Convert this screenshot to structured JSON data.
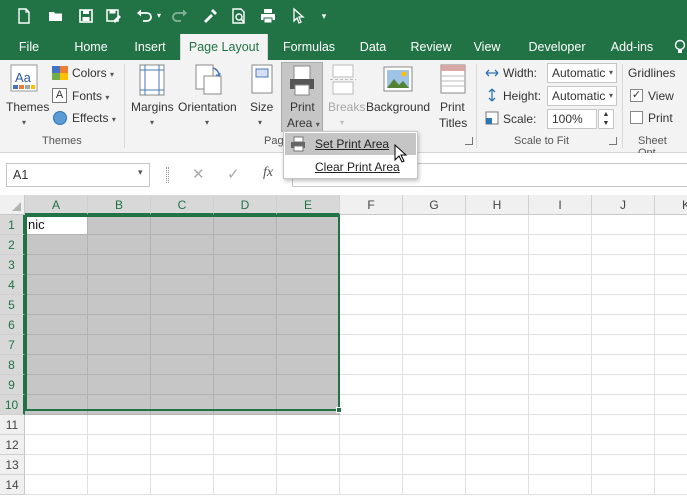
{
  "qat": {
    "icons": [
      "new-file-icon",
      "open-folder-icon",
      "save-icon",
      "save-as-icon",
      "undo-icon",
      "redo-icon",
      "format-painter-icon",
      "print-preview-icon",
      "print-icon",
      "pointer-icon",
      "customize-dropdown-icon"
    ]
  },
  "tabs": [
    {
      "label": "File"
    },
    {
      "label": "Home"
    },
    {
      "label": "Insert"
    },
    {
      "label": "Page Layout"
    },
    {
      "label": "Formulas"
    },
    {
      "label": "Data"
    },
    {
      "label": "Review"
    },
    {
      "label": "View"
    },
    {
      "label": "Developer"
    },
    {
      "label": "Add-ins"
    }
  ],
  "ribbon": {
    "themes": {
      "themes_label": "Themes",
      "colors_label": "Colors",
      "fonts_label": "Fonts",
      "effects_label": "Effects",
      "group_label": "Themes"
    },
    "page_setup": {
      "margins_label": "Margins",
      "orientation_label": "Orientation",
      "size_label": "Size",
      "print_area_line1": "Print",
      "print_area_line2": "Area",
      "breaks_label": "Breaks",
      "background_label": "Background",
      "print_titles_line1": "Print",
      "print_titles_line2": "Titles",
      "group_label_partial": "Pag"
    },
    "scale_to_fit": {
      "width_label": "Width:",
      "width_value": "Automatic",
      "height_label": "Height:",
      "height_value": "Automatic",
      "scale_label": "Scale:",
      "scale_value": "100%",
      "group_label": "Scale to Fit"
    },
    "sheet_options": {
      "gridlines_label": "Gridlines",
      "view_label": "View",
      "view_checked": true,
      "print_label": "Print",
      "print_checked": false,
      "group_label_partial": "Sheet Opt"
    }
  },
  "print_area_menu": {
    "items": [
      {
        "label": "Set Print Area",
        "hovered": true
      },
      {
        "label": "Clear Print Area",
        "hovered": false
      }
    ]
  },
  "formula_bar": {
    "name_box": "A1",
    "fx_label": "fx",
    "formula_value": ""
  },
  "sheet": {
    "columns": [
      "A",
      "B",
      "C",
      "D",
      "E",
      "F",
      "G",
      "H",
      "I",
      "J",
      "K"
    ],
    "rows": [
      "1",
      "2",
      "3",
      "4",
      "5",
      "6",
      "7",
      "8",
      "9",
      "10",
      "11",
      "12",
      "13",
      "14"
    ],
    "cell_a1": "nic",
    "selection": "A1:E10",
    "selected_columns": 5,
    "selected_rows": 10,
    "accent_color": "#217346"
  }
}
